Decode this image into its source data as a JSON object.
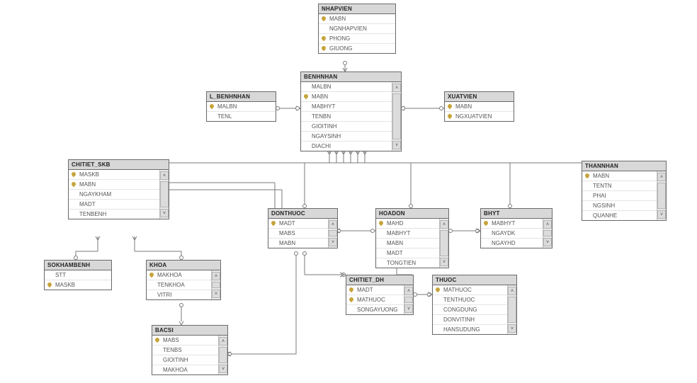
{
  "tables": {
    "nhapvien": {
      "title": "NHAPVIEN",
      "columns": [
        {
          "name": "MABN",
          "pk": true
        },
        {
          "name": "NGNHAPVIEN",
          "pk": false
        },
        {
          "name": "PHONG",
          "pk": true
        },
        {
          "name": "GIUONG",
          "pk": true
        }
      ]
    },
    "benhnhan": {
      "title": "BENHNHAN",
      "columns": [
        {
          "name": "MALBN",
          "pk": false
        },
        {
          "name": "MABN",
          "pk": true
        },
        {
          "name": "MABHYT",
          "pk": false
        },
        {
          "name": "TENBN",
          "pk": false
        },
        {
          "name": "GIOITINH",
          "pk": false
        },
        {
          "name": "NGAYSINH",
          "pk": false
        },
        {
          "name": "DIACHI",
          "pk": false
        }
      ]
    },
    "l_benhnhan": {
      "title": "L_BENHNHAN",
      "columns": [
        {
          "name": "MALBN",
          "pk": true
        },
        {
          "name": "TENL",
          "pk": false
        }
      ]
    },
    "xuatvien": {
      "title": "XUATVIEN",
      "columns": [
        {
          "name": "MABN",
          "pk": true
        },
        {
          "name": "NGXUATVIEN",
          "pk": true
        }
      ]
    },
    "chitiet_skb": {
      "title": "CHITIET_SKB",
      "columns": [
        {
          "name": "MASKB",
          "pk": true
        },
        {
          "name": "MABN",
          "pk": true
        },
        {
          "name": "NGAYKHAM",
          "pk": false
        },
        {
          "name": "MADT",
          "pk": false
        },
        {
          "name": "TENBENH",
          "pk": false
        }
      ]
    },
    "thannhan": {
      "title": "THANNHAN",
      "columns": [
        {
          "name": "MABN",
          "pk": true
        },
        {
          "name": "TENTN",
          "pk": false
        },
        {
          "name": "PHAI",
          "pk": false
        },
        {
          "name": "NGSINH",
          "pk": false
        },
        {
          "name": "QUANHE",
          "pk": false
        }
      ]
    },
    "donthuoc": {
      "title": "DONTHUOC",
      "columns": [
        {
          "name": "MADT",
          "pk": true
        },
        {
          "name": "MABS",
          "pk": false
        },
        {
          "name": "MABN",
          "pk": false
        }
      ]
    },
    "hoadon": {
      "title": "HOADON",
      "columns": [
        {
          "name": "MAHD",
          "pk": true
        },
        {
          "name": "MABHYT",
          "pk": false
        },
        {
          "name": "MABN",
          "pk": false
        },
        {
          "name": "MADT",
          "pk": false
        },
        {
          "name": "TONGTIEN",
          "pk": false
        }
      ]
    },
    "bhyt": {
      "title": "BHYT",
      "columns": [
        {
          "name": "MABHYT",
          "pk": true
        },
        {
          "name": "NGAYDK",
          "pk": false
        },
        {
          "name": "NGAYHD",
          "pk": false
        }
      ]
    },
    "sokhambenh": {
      "title": "SOKHAMBENH",
      "columns": [
        {
          "name": "STT",
          "pk": false
        },
        {
          "name": "MASKB",
          "pk": true
        }
      ]
    },
    "khoa": {
      "title": "KHOA",
      "columns": [
        {
          "name": "MAKHOA",
          "pk": true
        },
        {
          "name": "TENKHOA",
          "pk": false
        },
        {
          "name": "VITRI",
          "pk": false
        }
      ]
    },
    "chitiet_dh": {
      "title": "CHITIET_DH",
      "columns": [
        {
          "name": "MADT",
          "pk": true
        },
        {
          "name": "MATHUOC",
          "pk": true
        },
        {
          "name": "SONGAYUONG",
          "pk": false
        }
      ]
    },
    "thuoc": {
      "title": "THUOC",
      "columns": [
        {
          "name": "MATHUOC",
          "pk": true
        },
        {
          "name": "TENTHUOC",
          "pk": false
        },
        {
          "name": "CONGDUNG",
          "pk": false
        },
        {
          "name": "DONVITINH",
          "pk": false
        },
        {
          "name": "HANSUDUNG",
          "pk": false
        }
      ]
    },
    "bacsi": {
      "title": "BACSI",
      "columns": [
        {
          "name": "MABS",
          "pk": true
        },
        {
          "name": "TENBS",
          "pk": false
        },
        {
          "name": "GIOITINH",
          "pk": false
        },
        {
          "name": "MAKHOA",
          "pk": false
        }
      ]
    }
  },
  "table_order": [
    "nhapvien",
    "benhnhan",
    "l_benhnhan",
    "xuatvien",
    "chitiet_skb",
    "thannhan",
    "donthuoc",
    "hoadon",
    "bhyt",
    "sokhambenh",
    "khoa",
    "chitiet_dh",
    "thuoc",
    "bacsi"
  ],
  "relationships": [
    {
      "from": "NHAPVIEN",
      "to": "BENHNHAN"
    },
    {
      "from": "L_BENHNHAN",
      "to": "BENHNHAN"
    },
    {
      "from": "XUATVIEN",
      "to": "BENHNHAN"
    },
    {
      "from": "CHITIET_SKB",
      "to": "BENHNHAN"
    },
    {
      "from": "THANNHAN",
      "to": "BENHNHAN"
    },
    {
      "from": "DONTHUOC",
      "to": "BENHNHAN"
    },
    {
      "from": "HOADON",
      "to": "BENHNHAN"
    },
    {
      "from": "BHYT",
      "to": "BENHNHAN"
    },
    {
      "from": "CHITIET_SKB",
      "to": "DONTHUOC"
    },
    {
      "from": "HOADON",
      "to": "DONTHUOC"
    },
    {
      "from": "HOADON",
      "to": "BHYT"
    },
    {
      "from": "CHITIET_SKB",
      "to": "SOKHAMBENH"
    },
    {
      "from": "CHITIET_SKB",
      "to": "KHOA"
    },
    {
      "from": "DONTHUOC",
      "to": "CHITIET_DH"
    },
    {
      "from": "DONTHUOC",
      "to": "BACSI"
    },
    {
      "from": "KHOA",
      "to": "BACSI"
    },
    {
      "from": "CHITIET_DH",
      "to": "THUOC"
    },
    {
      "from": "HOADON",
      "to": "CHITIET_DH"
    }
  ]
}
